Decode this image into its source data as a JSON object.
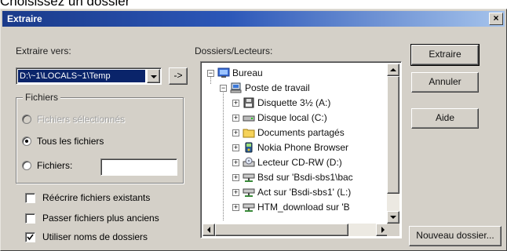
{
  "page_heading": "Choisissez un dossier",
  "window": {
    "title": "Extraire",
    "close_glyph": "×"
  },
  "left": {
    "extract_to_label": "Extraire vers:",
    "extract_to_value": "D:\\~1\\LOCALS~1\\Temp",
    "browse_label": "->",
    "files_group_title": "Fichiers",
    "radio_selected_files": "Fichiers sélectionnés",
    "radio_all_files": "Tous les fichiers",
    "radio_files": "Fichiers:",
    "files_field_value": "",
    "chk_overwrite": "Réécrire fichiers existants",
    "chk_skip_older": "Passer fichiers plus anciens",
    "chk_use_folder_names": "Utiliser noms de dossiers",
    "chk_use_folder_names_checked": true
  },
  "tree": {
    "label": "Dossiers/Lecteurs:",
    "items": [
      {
        "label": "Bureau",
        "icon": "desktop-icon",
        "level": 0,
        "expander": "−"
      },
      {
        "label": "Poste de travail",
        "icon": "computer-icon",
        "level": 1,
        "expander": "−"
      },
      {
        "label": "Disquette 3½ (A:)",
        "icon": "floppy-icon",
        "level": 2,
        "expander": "+"
      },
      {
        "label": "Disque local (C:)",
        "icon": "hard-drive-icon",
        "level": 2,
        "expander": "+"
      },
      {
        "label": "Documents partagés",
        "icon": "folder-icon",
        "level": 2,
        "expander": "+"
      },
      {
        "label": "Nokia Phone Browser",
        "icon": "phone-icon",
        "level": 2,
        "expander": "+"
      },
      {
        "label": "Lecteur CD-RW (D:)",
        "icon": "cd-drive-icon",
        "level": 2,
        "expander": "+"
      },
      {
        "label": "Bsd sur 'Bsdi-sbs1\\bac",
        "icon": "network-drive-icon",
        "level": 2,
        "expander": "+"
      },
      {
        "label": "Act sur 'Bsdi-sbs1' (L:)",
        "icon": "network-drive-icon",
        "level": 2,
        "expander": "+"
      },
      {
        "label": "HTM_download sur 'B",
        "icon": "network-drive-icon",
        "level": 2,
        "expander": "+"
      }
    ]
  },
  "buttons": {
    "extract": "Extraire",
    "cancel": "Annuler",
    "help": "Aide",
    "new_folder": "Nouveau dossier..."
  },
  "colors": {
    "dialog_bg": "#d4d0c8",
    "title_start": "#1a3a8a",
    "title_end": "#a6c4ec",
    "selection": "#0a246a"
  }
}
